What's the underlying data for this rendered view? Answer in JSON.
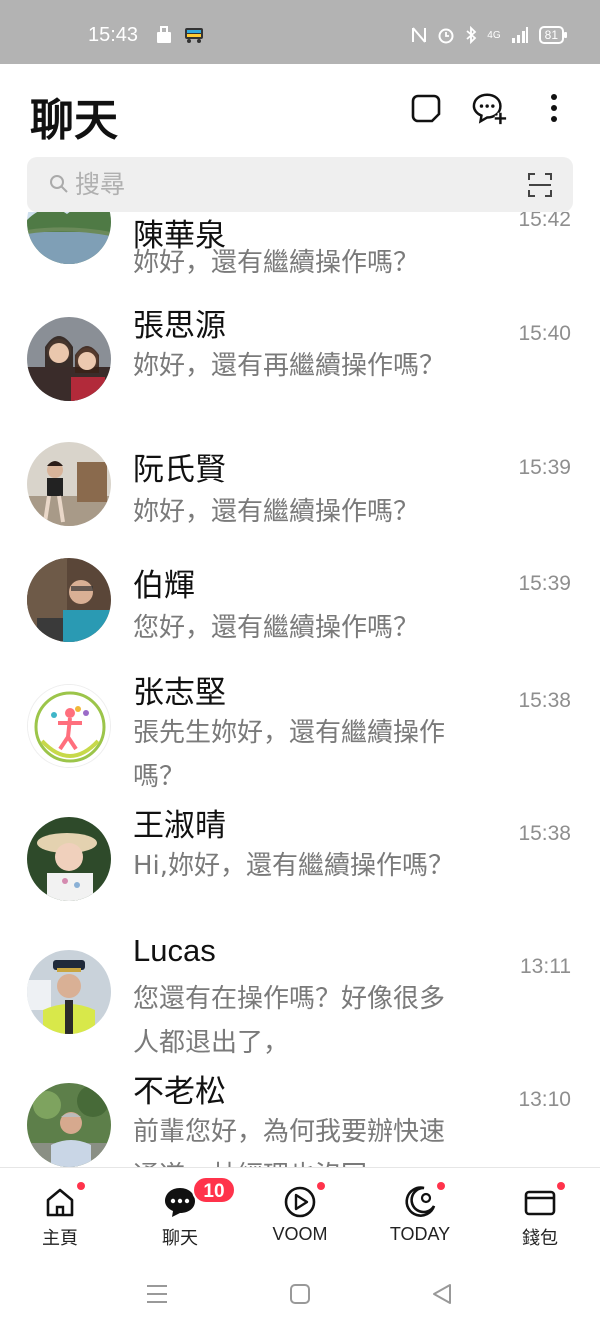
{
  "status_bar": {
    "time": "15:43",
    "battery": "81",
    "network": "4G"
  },
  "header": {
    "title": "聊天",
    "icons": [
      "note-icon",
      "new-chat-icon",
      "more-icon"
    ]
  },
  "search": {
    "placeholder": "搜尋"
  },
  "chats": [
    {
      "name": "陳華泉",
      "message": "妳好，還有繼續操作嗎？",
      "time": "15:42",
      "avatar": "landscape"
    },
    {
      "name": "張思源",
      "message": "妳好，還有再繼續操作嗎？",
      "time": "15:40",
      "avatar": "two-women"
    },
    {
      "name": "阮氏賢",
      "message": "妳好，還有繼續操作嗎？",
      "time": "15:39",
      "avatar": "woman-outdoors"
    },
    {
      "name": "伯輝",
      "message": "您好，還有繼續操作嗎？",
      "time": "15:39",
      "avatar": "man-glasses"
    },
    {
      "name": "张志堅",
      "message": "張先生妳好，還有繼續操作嗎？",
      "time": "15:38",
      "avatar": "logo-people"
    },
    {
      "name": "王淑晴",
      "message": "Hi,妳好，還有繼續操作嗎？",
      "time": "15:38",
      "avatar": "woman-hat"
    },
    {
      "name": "Lucas",
      "message": "您還有在操作嗎？好像很多人都退出了，",
      "time": "13:11",
      "avatar": "officer"
    },
    {
      "name": "不老松",
      "message": "前輩您好，為何我要辦快速通道，林經理也沒回",
      "time": "13:10",
      "avatar": "elder-man"
    }
  ],
  "bottom_nav": [
    {
      "label": "主頁",
      "icon": "home-icon",
      "dot": true
    },
    {
      "label": "聊天",
      "icon": "chat-icon",
      "badge": "10"
    },
    {
      "label": "VOOM",
      "icon": "voom-icon",
      "dot": true
    },
    {
      "label": "TODAY",
      "icon": "today-icon",
      "dot": true
    },
    {
      "label": "錢包",
      "icon": "wallet-icon",
      "dot": true
    }
  ],
  "colors": {
    "accent_red": "#ff334b",
    "status_bar_bg": "#b3b3b3",
    "search_bg": "#efefef"
  }
}
